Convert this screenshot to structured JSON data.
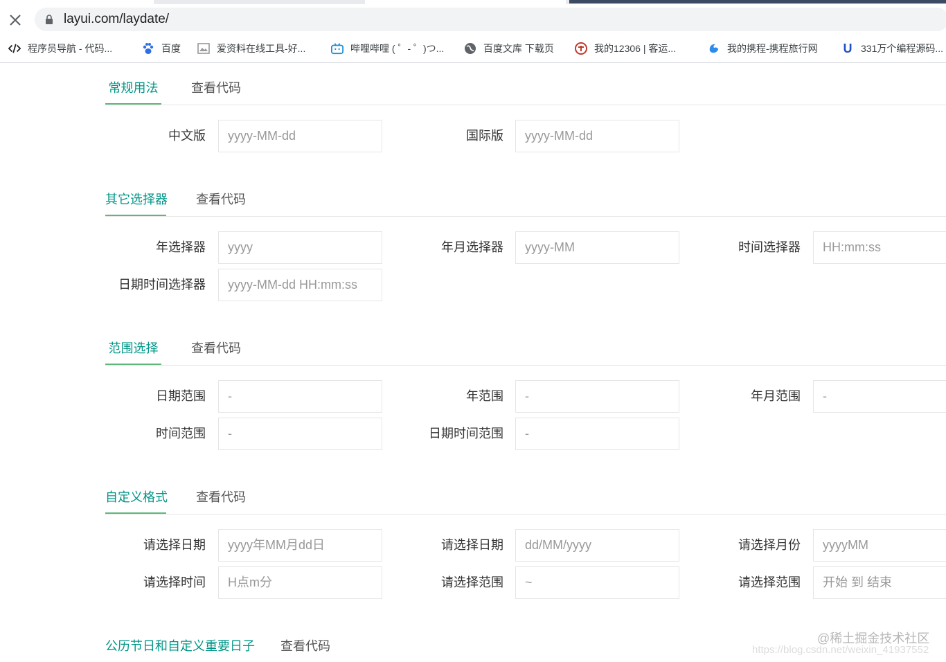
{
  "browser": {
    "url": "layui.com/laydate/",
    "bookmarks": [
      {
        "icon": "code-icon",
        "label": "程序员导航 - 代码..."
      },
      {
        "icon": "baidu-paw-icon",
        "label": "百度"
      },
      {
        "icon": "image-tool-icon",
        "label": "爱资料在线工具-好..."
      },
      {
        "icon": "bilibili-icon",
        "label": "哔哩哔哩 ( ゜- ゜)つ..."
      },
      {
        "icon": "globe-icon",
        "label": "百度文库 下载页"
      },
      {
        "icon": "railway-icon",
        "label": "我的12306 | 客运..."
      },
      {
        "icon": "ctrip-icon",
        "label": "我的携程-携程旅行网"
      },
      {
        "icon": "u-icon",
        "label": "331万个编程源码..."
      }
    ]
  },
  "sections": [
    {
      "tabs": [
        "常规用法",
        "查看代码"
      ],
      "fields": [
        {
          "label": "中文版",
          "placeholder": "yyyy-MM-dd"
        },
        {
          "label": "国际版",
          "placeholder": "yyyy-MM-dd"
        }
      ]
    },
    {
      "tabs": [
        "其它选择器",
        "查看代码"
      ],
      "fields": [
        {
          "label": "年选择器",
          "placeholder": "yyyy"
        },
        {
          "label": "年月选择器",
          "placeholder": "yyyy-MM"
        },
        {
          "label": "时间选择器",
          "placeholder": "HH:mm:ss"
        },
        {
          "label": "日期时间选择器",
          "placeholder": "yyyy-MM-dd HH:mm:ss"
        }
      ]
    },
    {
      "tabs": [
        "范围选择",
        "查看代码"
      ],
      "fields": [
        {
          "label": "日期范围",
          "placeholder": "-"
        },
        {
          "label": "年范围",
          "placeholder": "-"
        },
        {
          "label": "年月范围",
          "placeholder": "-"
        },
        {
          "label": "时间范围",
          "placeholder": "-"
        },
        {
          "label": "日期时间范围",
          "placeholder": "-"
        }
      ]
    },
    {
      "tabs": [
        "自定义格式",
        "查看代码"
      ],
      "fields": [
        {
          "label": "请选择日期",
          "placeholder": "yyyy年MM月dd日"
        },
        {
          "label": "请选择日期",
          "placeholder": "dd/MM/yyyy"
        },
        {
          "label": "请选择月份",
          "placeholder": "yyyyMM"
        },
        {
          "label": "请选择时间",
          "placeholder": "H点m分"
        },
        {
          "label": "请选择范围",
          "placeholder": "~"
        },
        {
          "label": "请选择范围",
          "placeholder": "开始 到 结束"
        }
      ]
    },
    {
      "tabs": [
        "公历节日和自定义重要日子",
        "查看代码"
      ],
      "fields": []
    }
  ],
  "watermark": {
    "line1": "@稀土掘金技术社区",
    "line2": "https://blog.csdn.net/weixin_41937552"
  },
  "colors": {
    "accent": "#009688",
    "underline": "#5FB878"
  }
}
